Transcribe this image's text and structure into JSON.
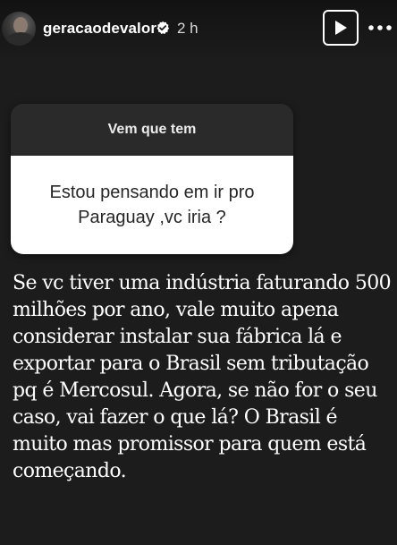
{
  "header": {
    "username": "geracaodevalor",
    "time": "2 h",
    "verified_color": "#ffffff"
  },
  "icons": {
    "avatar": "profile-avatar",
    "verified": "verified-badge-icon",
    "play": "play-icon",
    "more": "more-horizontal-icon"
  },
  "sticker": {
    "title": "Vem que tem",
    "question": "Estou pensando em ir pro Paraguay ,vc iria ?"
  },
  "answer": {
    "text": "Se vc tiver uma indústria faturando 500 milhões por ano, vale muito apena considerar instalar sua fábrica lá e exportar para o Brasil sem tributação pq é Mercosul. Agora, se não for o seu caso, vai fazer o que lá? O Brasil é muito mas promissor para quem está começando."
  },
  "colors": {
    "background": "#1c1c1c",
    "sticker_header": "#2a2a2a",
    "sticker_body": "#ffffff",
    "text_primary": "#ffffff"
  }
}
